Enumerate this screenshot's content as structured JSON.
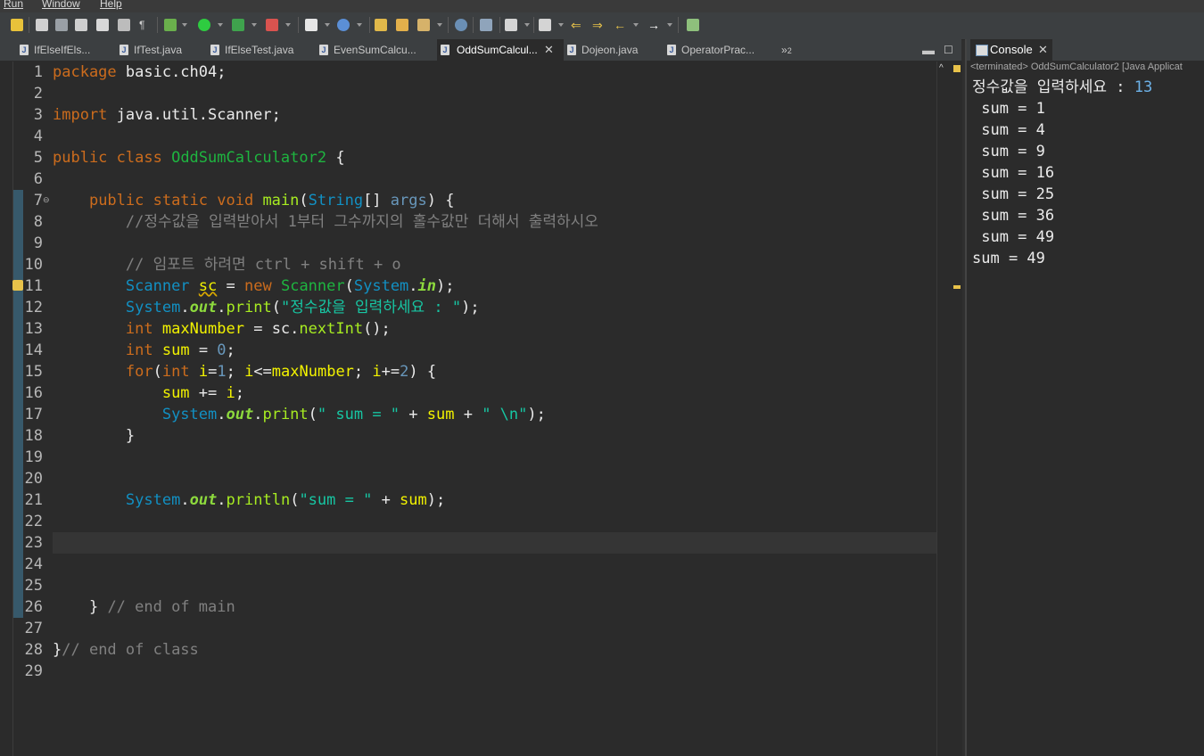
{
  "menubar": {
    "run": "Run",
    "window": "Window",
    "help": "Help"
  },
  "tabs": [
    {
      "label": "IfElseIfEls...",
      "active": false
    },
    {
      "label": "IfTest.java",
      "active": false
    },
    {
      "label": "IfElseTest.java",
      "active": false
    },
    {
      "label": "EvenSumCalcu...",
      "active": false
    },
    {
      "label": "OddSumCalcul...",
      "active": true
    },
    {
      "label": "Dojeon.java",
      "active": false
    },
    {
      "label": "OperatorPrac...",
      "active": false
    }
  ],
  "tab_overflow": {
    "chevron": "»",
    "count": "2"
  },
  "editor": {
    "line_numbers": [
      "1",
      "2",
      "3",
      "4",
      "5",
      "6",
      "7",
      "8",
      "9",
      "10",
      "11",
      "12",
      "13",
      "14",
      "15",
      "16",
      "17",
      "18",
      "19",
      "20",
      "21",
      "22",
      "23",
      "24",
      "25",
      "26",
      "27",
      "28",
      "29"
    ],
    "code": {
      "l1_kw": "package",
      "l1_rest": " basic.ch04;",
      "l3_kw": "import",
      "l3_rest": " java.util.Scanner;",
      "l5_kw": "public class",
      "l5_cls": "OddSumCalculator2",
      "l5_rest": " {",
      "l7_kw": "public static void",
      "l7_mth": "main",
      "l7_p1": "(",
      "l7_ty": "String",
      "l7_p2": "[] ",
      "l7_arg": "args",
      "l7_p3": ") {",
      "l8_cmt": "//정수값을 입력받아서 1부터 그수까지의 홀수값만 더해서 출력하시오",
      "l10_cmt": "// 임포트 하려면 ctrl + shift + o",
      "l11_ty": "Scanner",
      "l11_var": "sc",
      "l11_eq": " = ",
      "l11_kw": "new",
      "l11_cls": "Scanner",
      "l11_p1": "(",
      "l11_sys": "System",
      "l11_dot": ".",
      "l11_in": "in",
      "l11_end": ");",
      "l12_sys": "System",
      "l12_dot": ".",
      "l12_out": "out",
      "l12_dot2": ".",
      "l12_mth": "print",
      "l12_p1": "(",
      "l12_str": "\"정수값을 입력하세요 : \"",
      "l12_end": ");",
      "l13_kw": "int",
      "l13_var": "maxNumber",
      "l13_mid": " = sc.",
      "l13_mth": "nextInt",
      "l13_end": "();",
      "l14_kw": "int",
      "l14_var": "sum",
      "l14_mid": " = ",
      "l14_num": "0",
      "l14_end": ";",
      "l15_kw": "for",
      "l15_p1": "(",
      "l15_kw2": "int",
      "l15_var": "i",
      "l15_eq": "=",
      "l15_num1": "1",
      "l15_mid": "; ",
      "l15_var2": "i",
      "l15_le": "<=",
      "l15_var3": "maxNumber",
      "l15_mid2": "; ",
      "l15_var4": "i",
      "l15_pe": "+=",
      "l15_num2": "2",
      "l15_end": ") {",
      "l16_var": "sum",
      "l16_op": " += ",
      "l16_var2": "i",
      "l16_end": ";",
      "l17_sys": "System",
      "l17_dot": ".",
      "l17_out": "out",
      "l17_dot2": ".",
      "l17_mth": "print",
      "l17_p1": "(",
      "l17_str": "\" sum = \"",
      "l17_plus": " + ",
      "l17_var": "sum",
      "l17_plus2": " + ",
      "l17_str2": "\" \\n\"",
      "l17_end": ");",
      "l18": "}",
      "l21_sys": "System",
      "l21_dot": ".",
      "l21_out": "out",
      "l21_dot2": ".",
      "l21_mth": "println",
      "l21_p1": "(",
      "l21_str": "\"sum = \"",
      "l21_plus": " + ",
      "l21_var": "sum",
      "l21_end": ");",
      "l26_brace": "}",
      "l26_cmt": " // end of main",
      "l28_brace": "}",
      "l28_cmt": "// end of class"
    }
  },
  "console": {
    "tab_label": "Console",
    "title": "<terminated> OddSumCalculator2 [Java Applicat",
    "prompt": "정수값을 입력하세요 : ",
    "input": "13",
    "lines": [
      " sum = 1",
      " sum = 4",
      " sum = 9",
      " sum = 16",
      " sum = 25",
      " sum = 36",
      " sum = 49",
      "sum = 49"
    ]
  }
}
